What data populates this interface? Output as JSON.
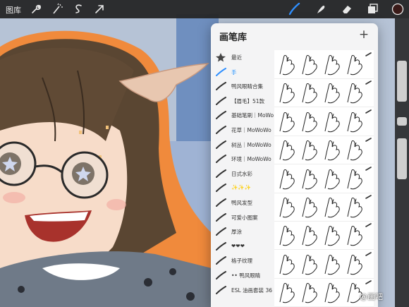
{
  "topbar": {
    "gallery_label": "图库",
    "tools": [
      "wrench-icon",
      "magic-wand-icon",
      "selection-s-icon",
      "arrow-transform-icon"
    ],
    "right_tools": [
      "brush-icon",
      "smudge-icon",
      "eraser-icon",
      "layers-icon",
      "color-icon"
    ],
    "accent": "#2f8fff",
    "active_color": "#3a1a18"
  },
  "panel": {
    "title": "画笔库",
    "add_label": "+",
    "categories": [
      {
        "label": "最近",
        "icon": "star-icon"
      },
      {
        "label": "手",
        "icon": "brush-stroke-icon",
        "active": true
      },
      {
        "label": "鸭风眼睛合集",
        "icon": "brush-stroke-icon"
      },
      {
        "label": "【眉毛】51款",
        "icon": "brush-stroke-icon"
      },
      {
        "label": "基础笔刷｜MoWoWo",
        "icon": "brush-stroke-icon"
      },
      {
        "label": "花草｜MoWoWo",
        "icon": "brush-stroke-icon"
      },
      {
        "label": "树丛｜MoWoWo",
        "icon": "brush-stroke-icon"
      },
      {
        "label": "环境｜MoWoWo",
        "icon": "brush-stroke-icon"
      },
      {
        "label": "日式水彩",
        "icon": "brush-stroke-icon"
      },
      {
        "label": "✨✨✨",
        "icon": "brush-stroke-icon"
      },
      {
        "label": "鸭风发型",
        "icon": "brush-stroke-icon"
      },
      {
        "label": "可爱小图案",
        "icon": "brush-stroke-icon"
      },
      {
        "label": "厚涂",
        "icon": "brush-stroke-icon"
      },
      {
        "label": "❤❤❤",
        "icon": "brush-stroke-icon"
      },
      {
        "label": "格子纹理",
        "icon": "brush-stroke-icon"
      },
      {
        "label": "•• 鸭风眼睛",
        "icon": "brush-stroke-icon"
      },
      {
        "label": "ESL 油画套装 36",
        "icon": "brush-stroke-icon"
      }
    ],
    "brush_rows": 9
  },
  "watermark": "@画吧"
}
